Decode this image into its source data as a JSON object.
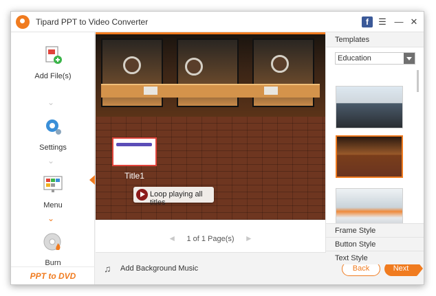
{
  "window": {
    "title": "Tipard PPT to Video Converter"
  },
  "titlebar": {
    "facebook_glyph": "f",
    "feedback_glyph": "☰",
    "minimize_glyph": "—",
    "close_glyph": "✕"
  },
  "sidebar": {
    "steps": [
      {
        "label": "Add File(s)",
        "icon": "add-file-icon"
      },
      {
        "label": "Settings",
        "icon": "gear-icon"
      },
      {
        "label": "Menu",
        "icon": "menu-layout-icon"
      },
      {
        "label": "Burn",
        "icon": "disc-burn-icon"
      }
    ],
    "active_step": "Menu",
    "footer_logo": "PPT to DVD",
    "chevron": "⌄"
  },
  "preview": {
    "title_text": "Title1",
    "loop_button_label": "Loop playing all titles"
  },
  "pager": {
    "prev": "◄",
    "next": "►",
    "text": "1 of 1 Page(s)"
  },
  "bottombar": {
    "music_glyph": "♫",
    "music_label": "Add Background Music",
    "back_label": "Back",
    "next_label": "Next"
  },
  "templates": {
    "header": "Templates",
    "category_selected": "Education",
    "selected_index": 1,
    "tabs": [
      "Frame Style",
      "Button Style",
      "Text Style"
    ]
  },
  "colors": {
    "accent": "#f07b1f",
    "highlight_red": "#e0443b"
  }
}
